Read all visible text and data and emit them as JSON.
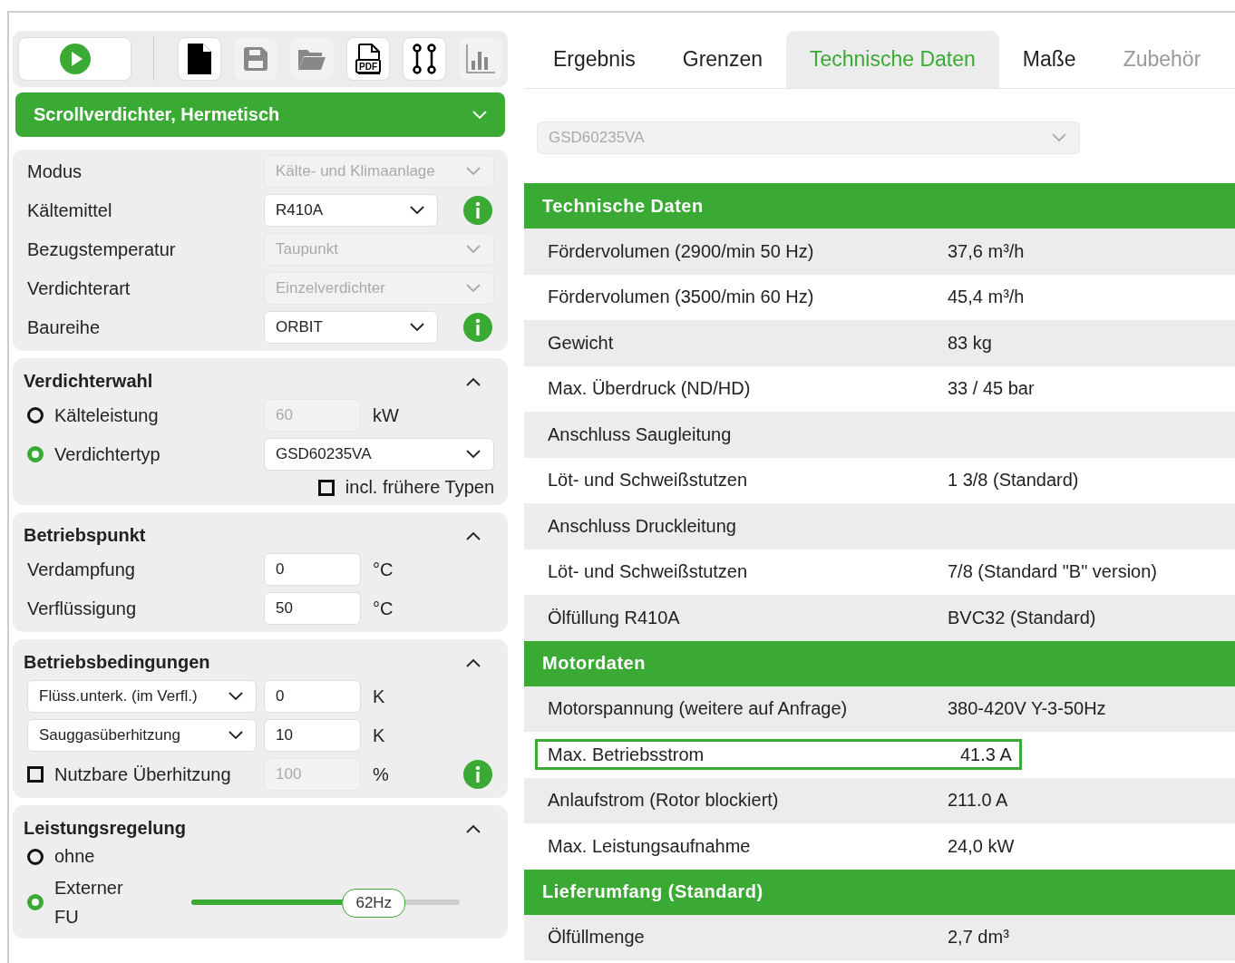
{
  "toolbar": [
    {
      "kind": "play",
      "disabled": false
    },
    {
      "kind": "new",
      "disabled": false
    },
    {
      "kind": "save",
      "disabled": true
    },
    {
      "kind": "open",
      "disabled": true
    },
    {
      "kind": "pdf",
      "disabled": false,
      "label": "PDF"
    },
    {
      "kind": "path",
      "disabled": false
    },
    {
      "kind": "chart",
      "disabled": true
    }
  ],
  "category": "Scrollverdichter, Hermetisch",
  "settings": [
    {
      "label": "Modus",
      "value": "Kälte- und Klimaanlage",
      "disabled": true,
      "info": false
    },
    {
      "label": "Kältemittel",
      "value": "R410A",
      "disabled": false,
      "info": true
    },
    {
      "label": "Bezugstemperatur",
      "value": "Taupunkt",
      "disabled": true,
      "info": false
    },
    {
      "label": "Verdichterart",
      "value": "Einzelverdichter",
      "disabled": true,
      "info": false
    },
    {
      "label": "Baureihe",
      "value": "ORBIT",
      "disabled": false,
      "info": true
    }
  ],
  "sections": [
    {
      "title": "Verdichterwahl",
      "expanded": true,
      "rows": [
        {
          "kind": "radio",
          "label": "Kälteleistung",
          "selected": false,
          "field": {
            "kind": "input",
            "value": "60",
            "disabled": true
          },
          "unit": "kW"
        },
        {
          "kind": "radio",
          "label": "Verdichtertyp",
          "selected": true,
          "field": {
            "kind": "select",
            "value": "GSD60235VA",
            "disabled": false
          }
        },
        {
          "kind": "option-check",
          "label": "incl. frühere Typen",
          "checked": false
        }
      ]
    },
    {
      "title": "Betriebspunkt",
      "expanded": true,
      "rows": [
        {
          "kind": "value",
          "label": "Verdampfung",
          "field": {
            "kind": "input",
            "value": "0",
            "disabled": false
          },
          "unit": "°C"
        },
        {
          "kind": "value",
          "label": "Verflüssigung",
          "field": {
            "kind": "input",
            "value": "50",
            "disabled": false
          },
          "unit": "°C"
        }
      ]
    },
    {
      "title": "Betriebsbedingungen",
      "expanded": true,
      "rows": [
        {
          "kind": "select-value",
          "choice": "Flüss.unterk. (im Verfl.)",
          "field": {
            "kind": "input",
            "value": "0",
            "disabled": false
          },
          "unit": "K"
        },
        {
          "kind": "select-value",
          "choice": "Sauggasüberhitzung",
          "field": {
            "kind": "input",
            "value": "10",
            "disabled": false
          },
          "unit": "K"
        },
        {
          "kind": "check-value",
          "label": "Nutzbare Überhitzung",
          "checked": false,
          "field": {
            "kind": "input",
            "value": "100",
            "disabled": true
          },
          "unit": "%",
          "info": true
        }
      ]
    },
    {
      "title": "Leistungsregelung",
      "expanded": true,
      "rows": [
        {
          "kind": "radio",
          "label": "ohne",
          "selected": false
        },
        {
          "kind": "radio-slider",
          "label": "Externer FU",
          "selected": true,
          "level": 0.68,
          "reading": "62Hz"
        }
      ]
    }
  ],
  "tabs": [
    {
      "label": "Ergebnis",
      "selected": false,
      "disabled": false
    },
    {
      "label": "Grenzen",
      "selected": false,
      "disabled": false
    },
    {
      "label": "Technische Daten",
      "selected": true,
      "disabled": false
    },
    {
      "label": "Maße",
      "selected": false,
      "disabled": false
    },
    {
      "label": "Zubehör",
      "selected": false,
      "disabled": true
    }
  ],
  "model_select": {
    "value": "GSD60235VA",
    "disabled": true
  },
  "tables": [
    {
      "title": "Technische Daten",
      "rows": [
        {
          "label": "Fördervolumen (2900/min 50 Hz)",
          "value": "37,6 m³/h",
          "highlighted": false
        },
        {
          "label": "Fördervolumen (3500/min 60 Hz)",
          "value": "45,4 m³/h",
          "highlighted": false
        },
        {
          "label": "Gewicht",
          "value": "83 kg",
          "highlighted": false
        },
        {
          "label": "Max. Überdruck (ND/HD)",
          "value": "33 / 45 bar",
          "highlighted": false
        },
        {
          "label": "Anschluss Saugleitung",
          "highlighted": false
        },
        {
          "label": "Löt- und Schweißstutzen",
          "value": "1 3/8 (Standard)",
          "highlighted": false
        },
        {
          "label": "Anschluss Druckleitung",
          "highlighted": false
        },
        {
          "label": "Löt- und Schweißstutzen",
          "value": "7/8 (Standard \"B\" version)",
          "highlighted": false
        },
        {
          "label": "Ölfüllung R410A",
          "value": "BVC32 (Standard)",
          "highlighted": false
        }
      ]
    },
    {
      "title": "Motordaten",
      "rows": [
        {
          "label": "Motorspannung (weitere auf Anfrage)",
          "value": "380-420V Y-3-50Hz",
          "highlighted": false
        },
        {
          "label": "Max. Betriebsstrom",
          "value": "41.3 A",
          "highlighted": true
        },
        {
          "label": "Anlaufstrom (Rotor blockiert)",
          "value": "211.0 A",
          "highlighted": false
        },
        {
          "label": "Max. Leistungsaufnahme",
          "value": "24,0 kW",
          "highlighted": false
        }
      ]
    },
    {
      "title": "Lieferumfang (Standard)",
      "rows": [
        {
          "label": "Ölfüllmenge",
          "value": "2,7 dm³",
          "highlighted": false
        }
      ]
    }
  ]
}
